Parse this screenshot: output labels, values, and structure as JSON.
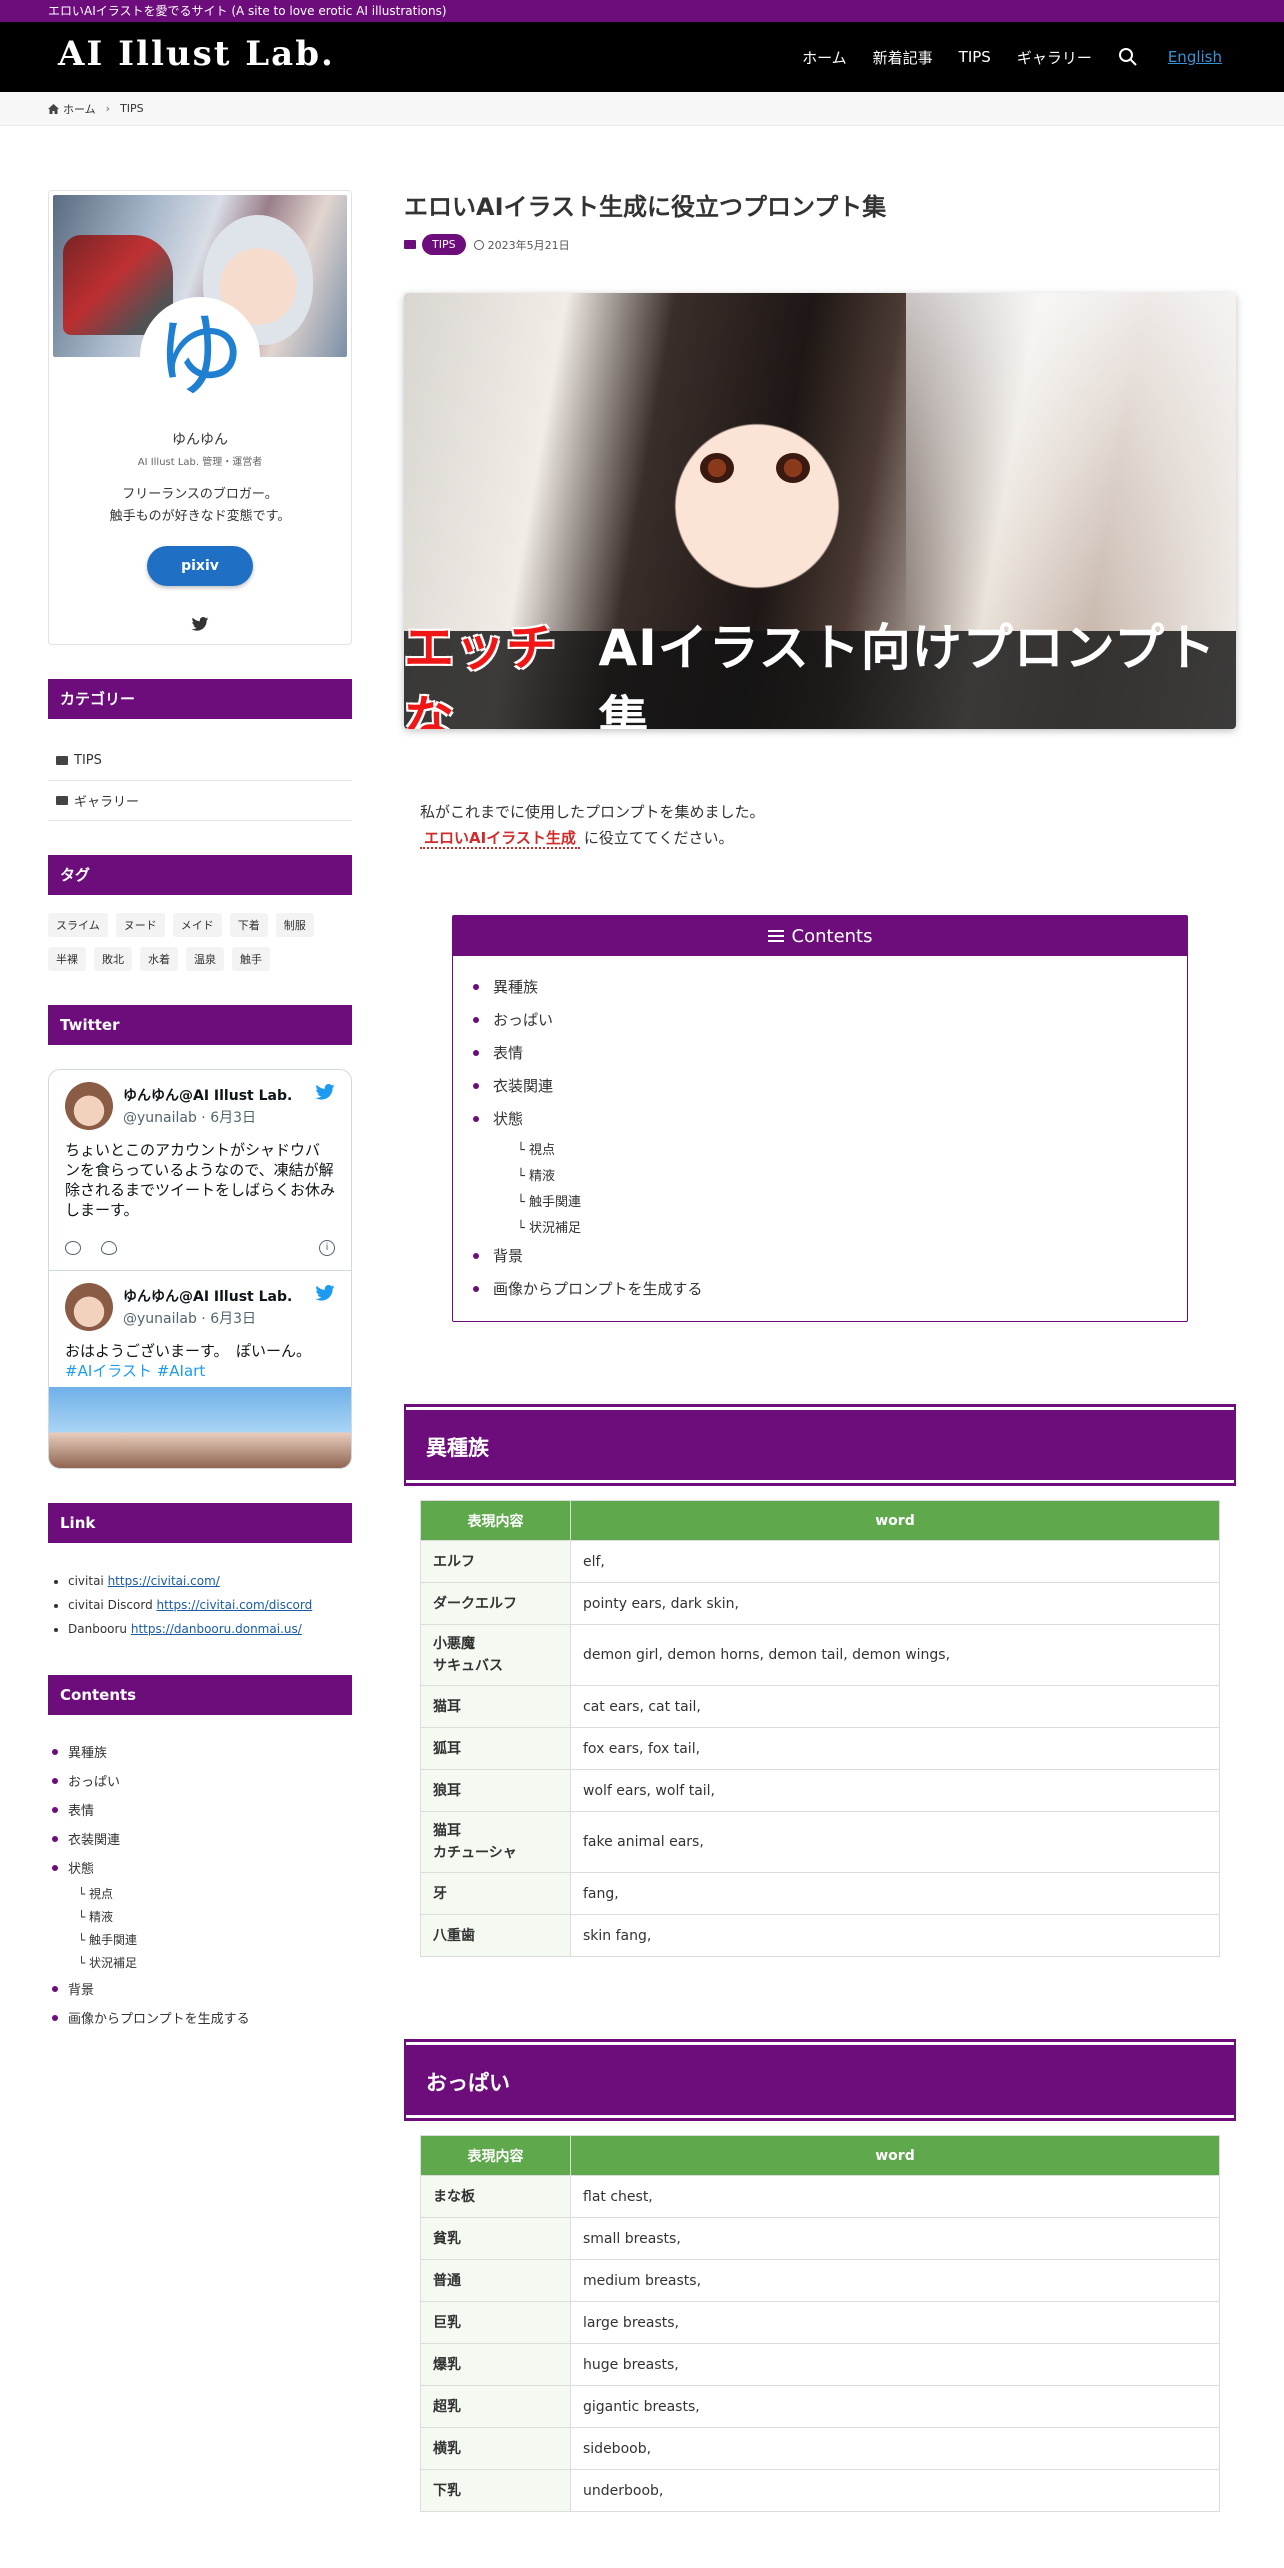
{
  "topbar": {
    "text": "エロいAIイラストを愛でるサイト (A site to love erotic AI illustrations)"
  },
  "header": {
    "logo": "AI Illust Lab.",
    "nav": [
      "ホーム",
      "新着記事",
      "TIPS",
      "ギャラリー"
    ],
    "language": "English"
  },
  "breadcrumb": {
    "home": "ホーム",
    "current": "TIPS"
  },
  "profile": {
    "avatar_char": "ゆ",
    "name": "ゆんゆん",
    "role": "AI Illust Lab. 管理・運営者",
    "desc1": "フリーランスのブロガー。",
    "desc2": "触手ものが好きなド変態です。",
    "button": "pixiv"
  },
  "category_widget": {
    "title": "カテゴリー",
    "items": [
      "TIPS",
      "ギャラリー"
    ]
  },
  "tag_widget": {
    "title": "タグ",
    "tags": [
      "スライム",
      "ヌード",
      "メイド",
      "下着",
      "制服",
      "半裸",
      "敗北",
      "水着",
      "温泉",
      "触手"
    ]
  },
  "twitter_widget": {
    "title": "Twitter",
    "tweets": [
      {
        "name": "ゆんゆん@AI Illust Lab.",
        "handle": "@yunailab · 6月3日",
        "text": "ちょいとこのアカウントがシャドウバンを食らっているようなので、凍結が解除されるまでツイートをしばらくお休みしまーす。"
      },
      {
        "name": "ゆんゆん@AI Illust Lab.",
        "handle": "@yunailab · 6月3日",
        "text": "おはようございまーす。　ぽいーん。",
        "hashtags": "#AIイラスト #AIart"
      }
    ]
  },
  "link_widget": {
    "title": "Link",
    "links": [
      {
        "label": "civitai ",
        "url": "https://civitai.com/"
      },
      {
        "label": "civitai Discord ",
        "url": "https://civitai.com/discord"
      },
      {
        "label": "Danbooru ",
        "url": "https://danbooru.donmai.us/"
      }
    ]
  },
  "toc": {
    "title": "Contents",
    "items": [
      "異種族",
      "おっぱい",
      "表情",
      "衣装関連",
      "状態"
    ],
    "sub_items": [
      "└ 視点",
      "└ 精液",
      "└ 触手関連",
      "└ 状況補足"
    ],
    "items_after": [
      "背景",
      "画像からプロンプトを生成する"
    ]
  },
  "post": {
    "title": "エロいAIイラスト生成に役立つプロンプト集",
    "category": "TIPS",
    "date": "2023年5月21日",
    "eyecatch_red": "エッチな",
    "eyecatch_white": "AIイラスト向けプロンプト集",
    "intro1": "私がこれまでに使用したプロンプトを集めました。",
    "intro_link": "エロいAIイラスト生成",
    "intro2": "に役立ててください。"
  },
  "table_headers": [
    "表現内容",
    "word"
  ],
  "sections": [
    {
      "title": "異種族",
      "rows": [
        [
          "エルフ",
          "elf,"
        ],
        [
          "ダークエルフ",
          "pointy ears, dark skin,"
        ],
        [
          "小悪魔\nサキュバス",
          "demon girl, demon horns, demon tail, demon wings,"
        ],
        [
          "猫耳",
          "cat ears, cat tail,"
        ],
        [
          "狐耳",
          "fox ears, fox tail,"
        ],
        [
          "狼耳",
          "wolf ears, wolf tail,"
        ],
        [
          "猫耳\nカチューシャ",
          "fake animal ears,"
        ],
        [
          "牙",
          "fang,"
        ],
        [
          "八重歯",
          "skin fang,"
        ]
      ]
    },
    {
      "title": "おっぱい",
      "rows": [
        [
          "まな板",
          "flat chest,"
        ],
        [
          "貧乳",
          "small breasts,"
        ],
        [
          "普通",
          "medium breasts,"
        ],
        [
          "巨乳",
          "large breasts,"
        ],
        [
          "爆乳",
          "huge breasts,"
        ],
        [
          "超乳",
          "gigantic breasts,"
        ],
        [
          "横乳",
          "sideboob,"
        ],
        [
          "下乳",
          "underboob,"
        ]
      ]
    }
  ]
}
